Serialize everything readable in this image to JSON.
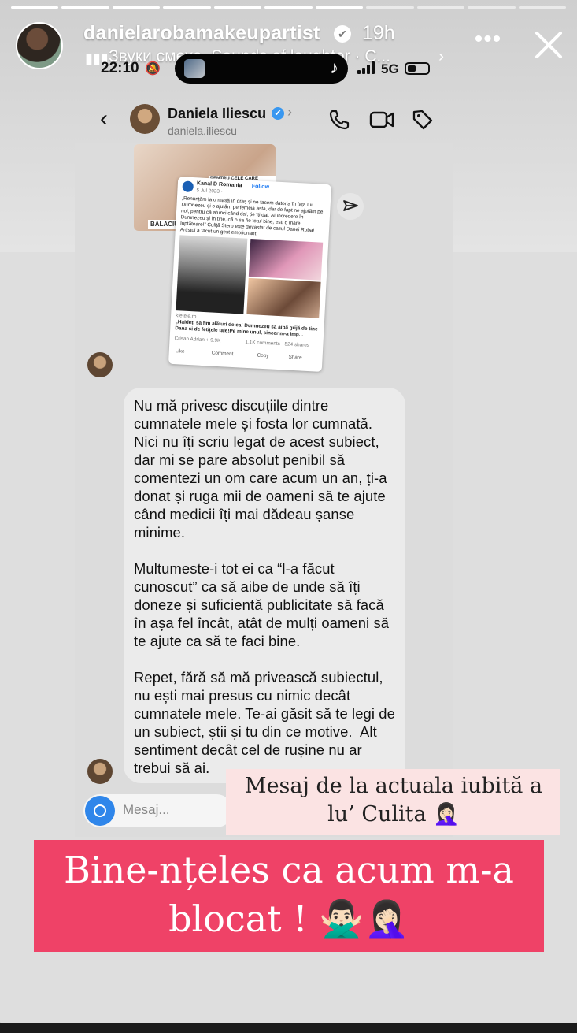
{
  "story": {
    "progress_segments": 11,
    "progress_done": 7,
    "username": "danielarobamakeupartist",
    "time_ago": "19h",
    "music": "Звуки смеха, Sounds of laughter · C...",
    "icons": [
      "verified-badge",
      "music-bars-icon",
      "more-icon",
      "close-icon"
    ]
  },
  "phone": {
    "status_time": "22:10",
    "network": "5G"
  },
  "dm": {
    "contact_name": "Daniela Iliescu",
    "contact_handle": "daniela.iliescu",
    "icons": [
      "back-icon",
      "phone-icon",
      "video-icon",
      "tag-icon",
      "share-icon",
      "camera-icon"
    ]
  },
  "shared_post": {
    "bg_label": "BALACIU DANI... luptătoare!",
    "bg_heading": "PENTRU CELE CARE DORESC",
    "page_name": "Kanal D Romania",
    "follow": "Follow",
    "date": "5 Jul 2023 · ",
    "caption": "„Renunțăm la o masă în oraș și ne facem datoria în fața lui Dumnezeu și o ajutăm pe femeia asta, dar de fapt ne ajutăm pe noi, pentru că atunci când dai, ție îți dai. Ai încredere în Dumnezeu și în tine, că o sa fie totul bine, esti o mare luptătoare!” Culiță Sterp este devastat de cazul Danei Roba! Artistul a făcut un gest emoționant",
    "link_domain": "kfetele.ro",
    "headline": "„Haideți să fim alături de ea! Dumnezeu să aibă grijă de tine Dana și de fetițele tale!Pe mine unul, sincer m-a imp...",
    "reactions": "Crisan Adrian + 9.9K",
    "stats": "1.1K comments · 524 shares",
    "actions": [
      "Like",
      "Comment",
      "Copy",
      "Share"
    ]
  },
  "message": {
    "text": "Nu mă privesc discuțiile dintre\ncumnatele mele și fosta lor cumnată.\nNici nu îți scriu legat de acest subiect,\ndar mi se pare absolut penibil să\ncomentezi un om care acum un an, ți-a\ndonat și ruga mii de oameni să te ajute\ncând medicii îți mai dădeau șanse\nminime.\n\nMultumeste-i tot ei ca “l-a făcut\ncunoscut” ca să aibe de unde să îți\ndoneze și suficientă publicitate să facă\nîn așa fel încât, atât de mulți oameni să\nte ajute ca să te faci bine.\n\nRepet, fără să mă privească subiectul,\nnu ești mai presus cu nimic decât\ncumnatele mele. Te-ai găsit să te legi de\nun subiect, știi și tu din ce motive.  Alt\nsentiment decât cel de rușine nu ar\ntrebui să ai.",
    "input_placeholder": "Mesaj..."
  },
  "captions": {
    "first": "Mesaj de la actuala iubită a lu’ Culita 🤦🏻‍♀️",
    "second": "Bine-nțeles ca acum m-a blocat ! 🙅🏻‍♂️🤦🏻‍♀️"
  },
  "colors": {
    "caption_pink_bg": "#fbe3e3",
    "caption_red_bg": "#ef4267",
    "verified_blue": "#3897f0",
    "camera_blue": "#2f86ea"
  }
}
